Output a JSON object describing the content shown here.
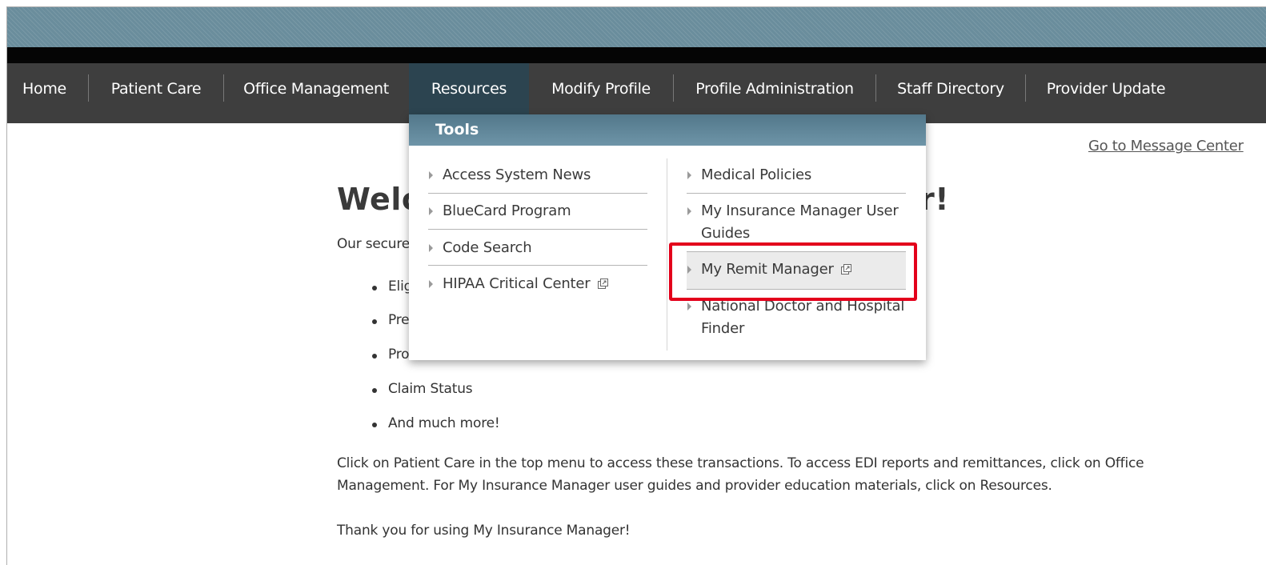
{
  "nav": {
    "items": [
      {
        "label": "Home"
      },
      {
        "label": "Patient Care"
      },
      {
        "label": "Office Management"
      },
      {
        "label": "Resources"
      },
      {
        "label": "Modify Profile"
      },
      {
        "label": "Profile Administration"
      },
      {
        "label": "Staff Directory"
      },
      {
        "label": "Provider Update"
      }
    ],
    "active": "Resources"
  },
  "message_center_link": "Go to Message Center",
  "main": {
    "welcome_left": "Welc",
    "welcome_right": "r!",
    "intro_partial": "Our secure",
    "bullets": [
      "Elig",
      "Pre",
      "Pro",
      "Claim Status",
      "And much more!"
    ],
    "paragraph1": "Click on Patient Care in the top menu to access these transactions. To access EDI reports and remittances, click on Office Management. For My Insurance Manager user guides and provider education materials, click on Resources.",
    "paragraph2": "Thank you for using My Insurance Manager!"
  },
  "dropdown": {
    "header": "Tools",
    "left_column": [
      {
        "label": "Access System News",
        "external": false
      },
      {
        "label": "BlueCard Program",
        "external": false
      },
      {
        "label": "Code Search",
        "external": false
      },
      {
        "label": "HIPAA Critical Center",
        "external": true
      }
    ],
    "right_column": [
      {
        "label": "Medical Policies",
        "external": false
      },
      {
        "label": "My Insurance Manager User Guides",
        "external": false
      },
      {
        "label": "My Remit Manager",
        "external": true
      },
      {
        "label": "National Doctor and Hospital Finder",
        "external": false
      }
    ],
    "highlighted_item": "My Remit Manager"
  },
  "colors": {
    "nav_bg": "#3e3e3e",
    "nav_active_bg": "#2c4450",
    "banner": "#6a8d9c",
    "dropdown_header": "#5f8597",
    "highlight_border": "#e3001b"
  },
  "icons": {
    "external_link": "external-link-icon",
    "menu_arrow": "caret-right-icon"
  }
}
